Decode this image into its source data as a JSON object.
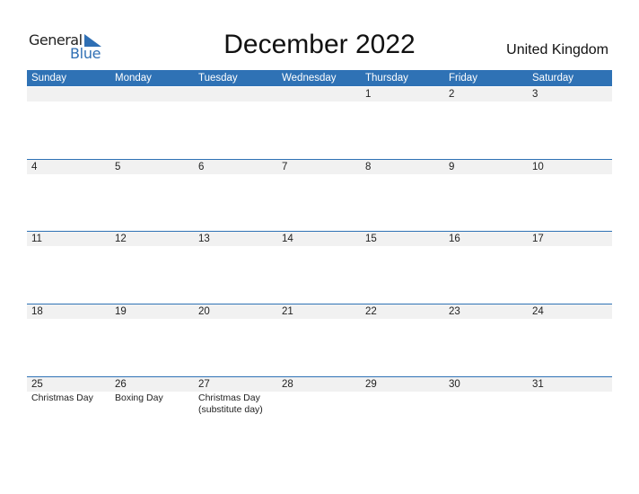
{
  "logo": {
    "line1": "General",
    "line2": "Blue"
  },
  "title": "December 2022",
  "country": "United Kingdom",
  "colors": {
    "accent": "#2f72b5",
    "date_strip": "#f1f1f1"
  },
  "weekdays": [
    "Sunday",
    "Monday",
    "Tuesday",
    "Wednesday",
    "Thursday",
    "Friday",
    "Saturday"
  ],
  "weeks": [
    {
      "days": [
        "",
        "",
        "",
        "",
        "1",
        "2",
        "3"
      ],
      "events": [
        "",
        "",
        "",
        "",
        "",
        "",
        ""
      ]
    },
    {
      "days": [
        "4",
        "5",
        "6",
        "7",
        "8",
        "9",
        "10"
      ],
      "events": [
        "",
        "",
        "",
        "",
        "",
        "",
        ""
      ]
    },
    {
      "days": [
        "11",
        "12",
        "13",
        "14",
        "15",
        "16",
        "17"
      ],
      "events": [
        "",
        "",
        "",
        "",
        "",
        "",
        ""
      ]
    },
    {
      "days": [
        "18",
        "19",
        "20",
        "21",
        "22",
        "23",
        "24"
      ],
      "events": [
        "",
        "",
        "",
        "",
        "",
        "",
        ""
      ]
    },
    {
      "days": [
        "25",
        "26",
        "27",
        "28",
        "29",
        "30",
        "31"
      ],
      "events": [
        "Christmas Day",
        "Boxing Day",
        "Christmas Day (substitute day)",
        "",
        "",
        "",
        ""
      ]
    }
  ]
}
